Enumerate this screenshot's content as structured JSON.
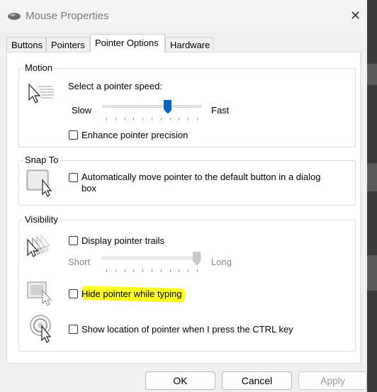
{
  "window": {
    "title": "Mouse Properties",
    "close_glyph": "✕"
  },
  "tabs": [
    {
      "label": "Buttons",
      "active": false
    },
    {
      "label": "Pointers",
      "active": false
    },
    {
      "label": "Pointer Options",
      "active": true
    },
    {
      "label": "Hardware",
      "active": false
    }
  ],
  "motion": {
    "legend": "Motion",
    "speed_label": "Select a pointer speed:",
    "slow_label": "Slow",
    "fast_label": "Fast",
    "speed_level": 0.68,
    "enhance_label": "Enhance pointer precision",
    "enhance_checked": false
  },
  "snap_to": {
    "legend": "Snap To",
    "auto_move_label_line1": "Automatically move pointer to the default button in a dialog",
    "auto_move_label_line2": "box",
    "checked": false
  },
  "visibility": {
    "legend": "Visibility",
    "trails_label": "Display pointer trails",
    "trails_checked": false,
    "short_label": "Short",
    "long_label": "Long",
    "trail_level": 1.0,
    "hide_label": "Hide pointer while typing",
    "hide_checked": false,
    "show_location_label": "Show location of pointer when I press the CTRL key",
    "show_location_checked": false
  },
  "buttons": {
    "ok": "OK",
    "cancel": "Cancel",
    "apply": "Apply"
  },
  "colors": {
    "slider_accent": "#0067c0",
    "highlight": "#ffff00"
  },
  "icons": [
    "mouse-icon",
    "close-icon",
    "pointer-speed-icon",
    "snap-to-icon",
    "pointer-trails-icon",
    "hide-pointer-icon",
    "show-location-icon"
  ]
}
